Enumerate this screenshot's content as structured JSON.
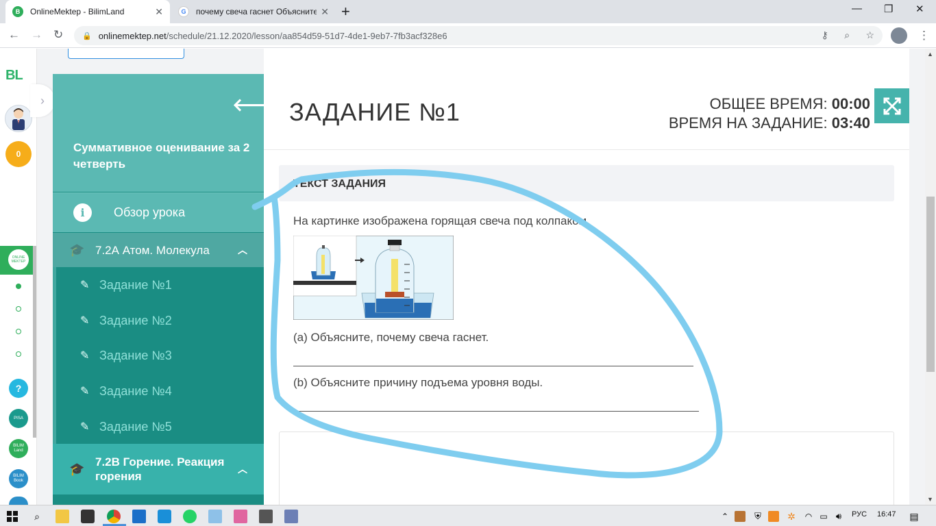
{
  "browser": {
    "tabs": [
      {
        "label": "OnlineMektep - BilimLand",
        "close": "✕"
      },
      {
        "label": "почему свеча гаснет Объясните",
        "close": "✕"
      }
    ],
    "new_tab": "+",
    "window": {
      "minimize": "—",
      "restore": "❐",
      "close": "✕"
    },
    "url_host": "onlinemektep.net",
    "url_path": "/schedule/21.12.2020/lesson/aa854d59-51d7-4de1-9eb7-7fb3acf328e6"
  },
  "rail": {
    "logo": "BL",
    "coins": "0",
    "online_badge": "ONLINE MEKTEP",
    "help": "?",
    "pisa": "PISA",
    "bilimland": "BILIM Land",
    "bilimbook": "BILIM Book"
  },
  "sidebar": {
    "title": "Суммативное оценивание за 2 четверть",
    "overview": "Обзор урока",
    "topic1": "7.2А Атом. Молекула",
    "items": [
      {
        "label": "Задание №1"
      },
      {
        "label": "Задание №2"
      },
      {
        "label": "Задание №3"
      },
      {
        "label": "Задание №4"
      },
      {
        "label": "Задание №5"
      }
    ],
    "topic2": "7.2В Горение. Реакция горения"
  },
  "task": {
    "title": "ЗАДАНИЕ №1",
    "total_time_label": "ОБЩЕЕ ВРЕМЯ:",
    "total_time": "00:00",
    "task_time_label": "ВРЕМЯ НА ЗАДАНИЕ:",
    "task_time": "03:40",
    "section_header": "ТЕКСТ ЗАДАНИЯ",
    "intro": "На картинке изображена горящая свеча под колпаком.",
    "question_a": "(а) Объясните, почему свеча гаснет.",
    "question_b": "(b) Объясните причину подъема уровня воды."
  },
  "taskbar": {
    "lang": "РУС",
    "time": "16:47"
  },
  "colors": {
    "sidebar_dark": "#1a8d83",
    "sidebar_light": "#5bb9b3",
    "accent_green": "#2fae5b",
    "scribble": "#7fcdef"
  }
}
